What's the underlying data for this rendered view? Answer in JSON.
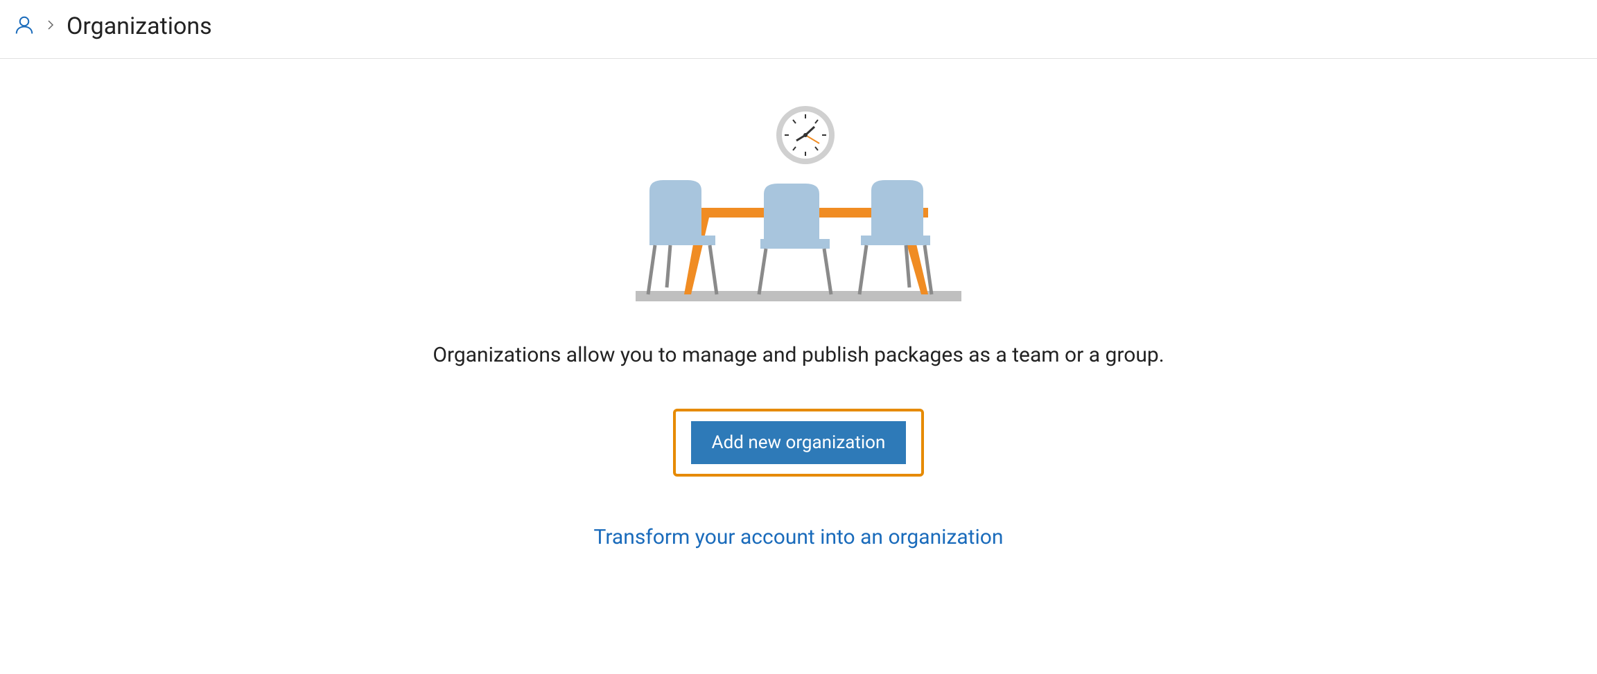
{
  "breadcrumb": {
    "page_title": "Organizations"
  },
  "main": {
    "description": "Organizations allow you to manage and publish packages as a team or a group.",
    "add_button_label": "Add new organization",
    "transform_link_label": "Transform your account into an organization"
  },
  "colors": {
    "accent_blue": "#2e7ab8",
    "link_blue": "#1a6bbb",
    "highlight_orange": "#e68a00",
    "ill_blue": "#a8c5dd",
    "ill_orange": "#f08c23",
    "ill_grey": "#b5b5b5",
    "ill_floor": "#bfbfbf"
  }
}
